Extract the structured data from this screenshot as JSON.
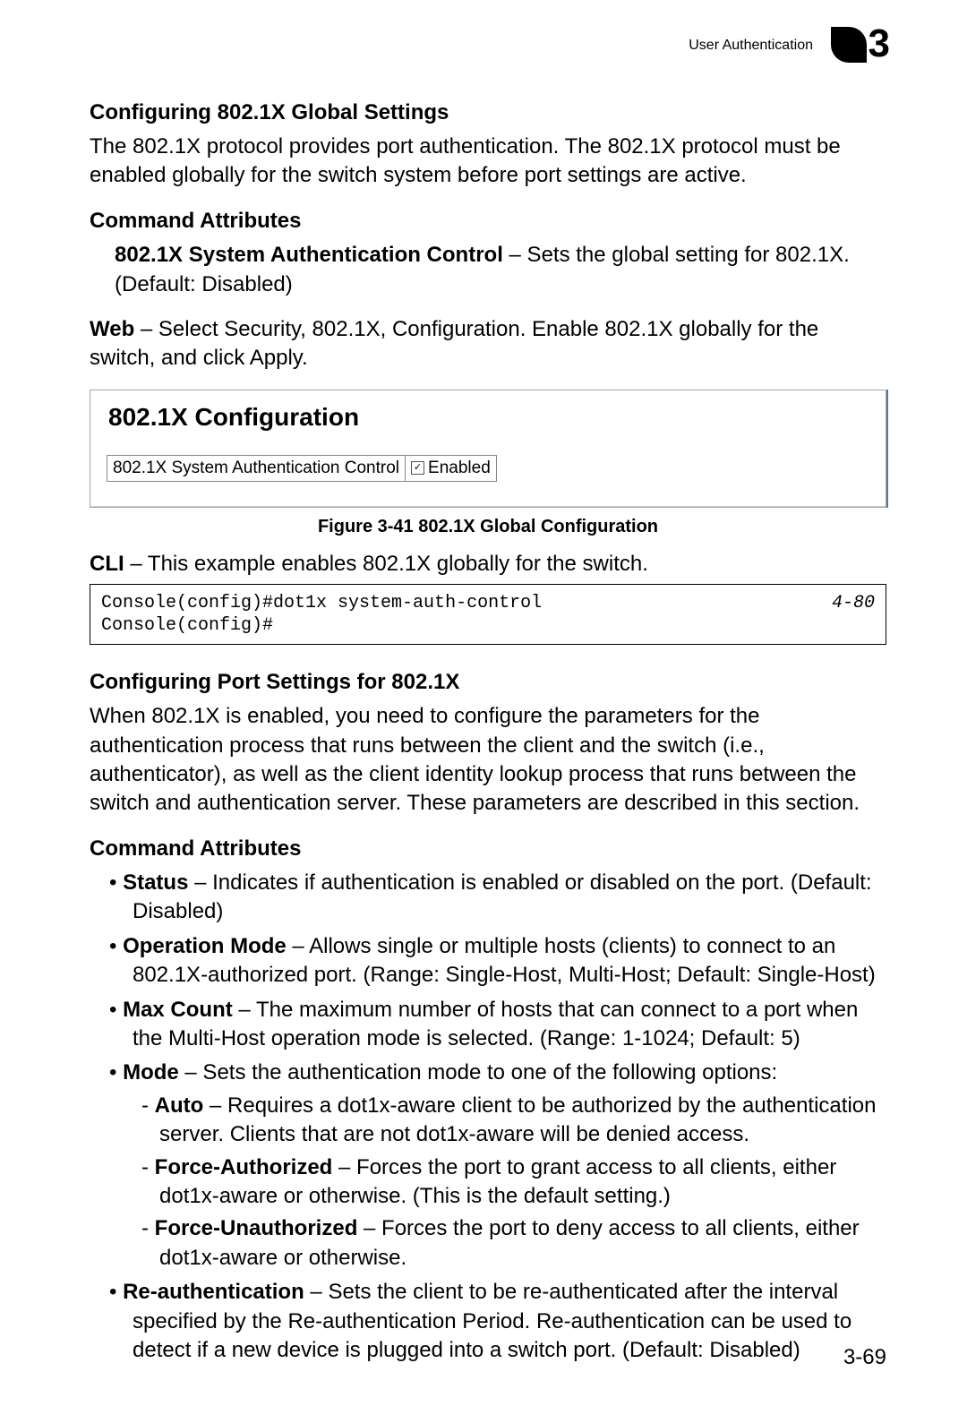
{
  "header": {
    "title": "User Authentication",
    "chapter": "3"
  },
  "section1": {
    "heading": "Configuring 802.1X Global Settings",
    "intro": "The 802.1X protocol provides port authentication. The 802.1X protocol must be enabled globally for the switch system before port settings are active.",
    "cmd_attr_label": "Command Attributes",
    "attr_bold": "802.1X System Authentication Control",
    "attr_rest": " – Sets the global setting for 802.1X. (Default: Disabled)",
    "web_bold": "Web",
    "web_rest": " – Select Security, 802.1X, Configuration. Enable 802.1X globally for the switch, and click Apply."
  },
  "screenshot": {
    "title": "802.1X Configuration",
    "row_label": "802.1X System Authentication Control",
    "row_value": "Enabled",
    "caption": "Figure 3-41   802.1X Global Configuration"
  },
  "cli": {
    "lead_bold": "CLI",
    "lead_rest": " – This example enables 802.1X globally for the switch.",
    "code": "Console(config)#dot1x system-auth-control\nConsole(config)#",
    "ref": "4-80"
  },
  "section2": {
    "heading": "Configuring Port Settings for 802.1X",
    "intro": "When 802.1X is enabled, you need to configure the parameters for the authentication process that runs between the client and the switch (i.e., authenticator), as well as the client identity lookup process that runs between the switch and authentication server. These parameters are described in this section.",
    "cmd_attr_label": "Command Attributes",
    "items": [
      {
        "bold": "Status",
        "rest": " – Indicates if authentication is enabled or disabled on the port. (Default: Disabled)"
      },
      {
        "bold": "Operation Mode",
        "rest": " – Allows single or multiple hosts (clients) to connect to an 802.1X-authorized port. (Range: Single-Host, Multi-Host; Default: Single-Host)"
      },
      {
        "bold": "Max Count",
        "rest": " – The maximum number of hosts that can connect to a port when the Multi-Host operation mode is selected. (Range: 1-1024; Default: 5)"
      },
      {
        "bold": "Mode",
        "rest": " – Sets the authentication mode to one of the following options:",
        "sub": [
          {
            "bold": "Auto",
            "rest": " – Requires a dot1x-aware client to be authorized by the authentication server. Clients that are not dot1x-aware will be denied access."
          },
          {
            "bold": "Force-Authorized",
            "rest": " – Forces the port to grant access to all clients, either dot1x-aware or otherwise. (This is the default setting.)"
          },
          {
            "bold": "Force-Unauthorized",
            "rest": " – Forces the port to deny access to all clients, either dot1x-aware or otherwise."
          }
        ]
      },
      {
        "bold": "Re-authentication",
        "rest": " – Sets the client to be re-authenticated after the interval specified by the Re-authentication Period. Re-authentication can be used to detect if a new device is plugged into a switch port. (Default: Disabled)"
      }
    ]
  },
  "page_number": "3-69"
}
